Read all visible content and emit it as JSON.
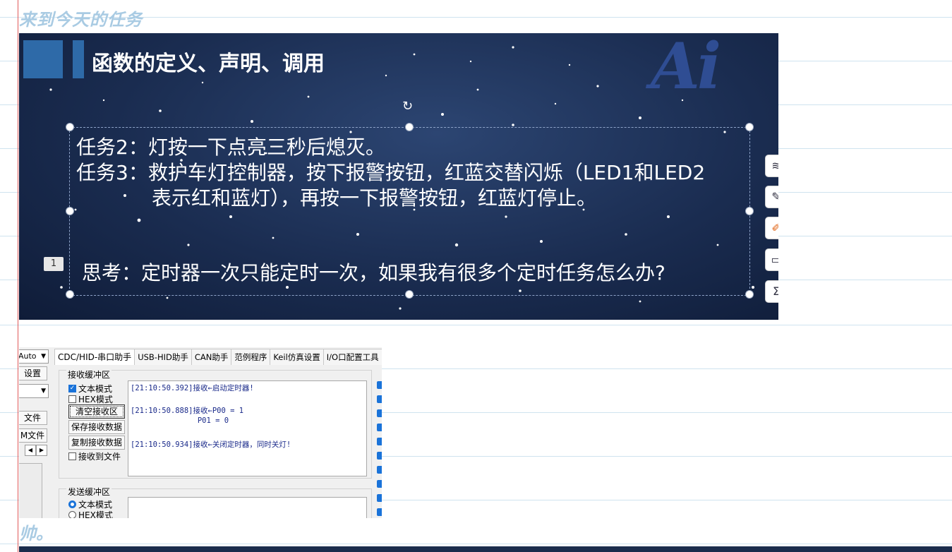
{
  "note": {
    "heading": "来到今天的任务",
    "tail": "帅。"
  },
  "slide": {
    "title": "函数的定义、声明、调用",
    "logo": "Ai",
    "task2": "任务2：灯按一下点亮三秒后熄灭。",
    "task3_line1": "任务3：救护车灯控制器，按下报警按钮，红蓝交替闪烁（LED1和LED2",
    "task3_line2": "表示红和蓝灯），再按一下报警按钮，红蓝灯停止。",
    "badge": "1",
    "think": "思考：定时器一次只能定时一次，如果我有很多个定时任务怎么办?"
  },
  "serial": {
    "tabs": [
      {
        "label": "CDC/HID-串口助手"
      },
      {
        "label": "USB-HID助手"
      },
      {
        "label": "CAN助手"
      },
      {
        "label": "范例程序"
      },
      {
        "label": "Keil仿真设置"
      },
      {
        "label": "I/O口配置工具"
      }
    ],
    "left": {
      "auto_select": "Auto",
      "settings_button": "设置",
      "file_button": "文件",
      "file_button2": "M文件"
    },
    "recv_group_label": "接收缓冲区",
    "text_mode": "文本模式",
    "hex_mode": "HEX模式",
    "clear_recv": "清空接收区",
    "save_recv": "保存接收数据",
    "copy_recv": "复制接收数据",
    "recv_to_file": "接收到文件",
    "log": [
      "[21:10:50.392]接收←启动定时器!",
      "[21:10:50.888]接收←P00 = 1",
      "               P01 = 0",
      "[21:10:50.934]接收←关闭定时器，同时关灯!"
    ],
    "send_group_label": "发送缓冲区",
    "send_text_mode": "文本模式",
    "send_hex_mode": "HEX模式"
  }
}
